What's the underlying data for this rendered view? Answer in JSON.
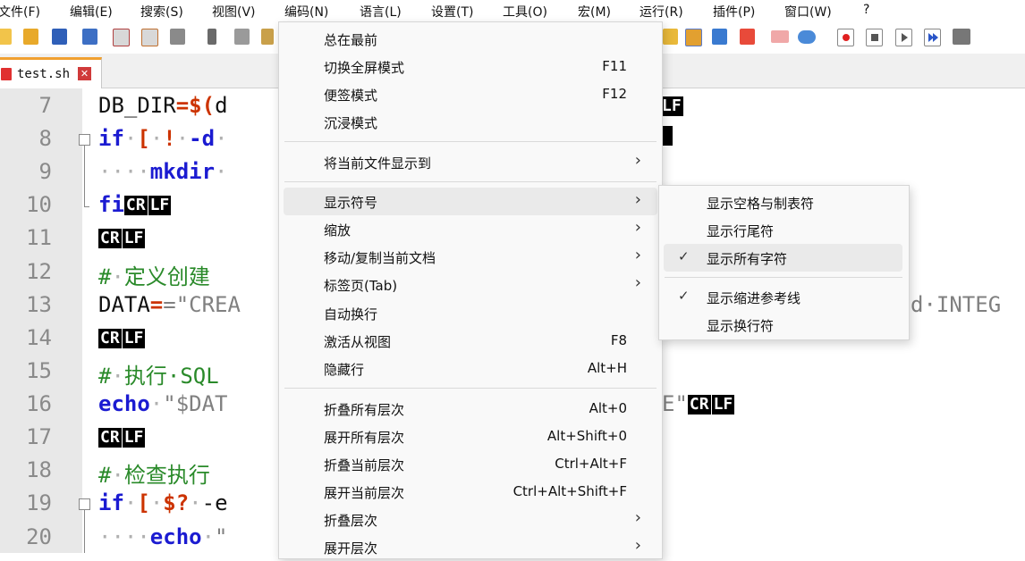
{
  "menubar": {
    "items": [
      "文件(F)",
      "编辑(E)",
      "搜索(S)",
      "视图(V)",
      "编码(N)",
      "语言(L)",
      "设置(T)",
      "工具(O)",
      "宏(M)",
      "运行(R)",
      "插件(P)",
      "窗口(W)",
      "?"
    ]
  },
  "toolbar": {
    "icons": [
      "new-file-icon",
      "open-folder-icon",
      "save-icon",
      "save-all-icon",
      "close-icon",
      "close-all-icon",
      "print-icon",
      "cut-icon",
      "copy-icon",
      "paste-icon",
      "sync-icon",
      "map-icon",
      "doc-icon",
      "function-icon",
      "folder-icon",
      "monitor-eye-icon",
      "record-macro-icon",
      "stop-macro-icon",
      "play-macro-icon",
      "play-multiple-icon",
      "save-macro-icon"
    ]
  },
  "tab": {
    "filename": "test.sh",
    "close_glyph": "✕"
  },
  "editor": {
    "line_numbers": [
      "7",
      "8",
      "9",
      "10",
      "11",
      "12",
      "13",
      "14",
      "15",
      "16",
      "17",
      "18",
      "19",
      "20"
    ],
    "line7": {
      "a": "DB_DIR",
      "b": "=$(",
      "c": "d"
    },
    "line8": {
      "a": "if",
      "b": "[",
      "c": "!",
      "d": "-d"
    },
    "line9": {
      "a": "mkdir"
    },
    "line10": {
      "a": "fi"
    },
    "line12": {
      "a": "#",
      "b": "定义创建"
    },
    "line13": {
      "a": "DATA",
      "b": "=\"CREA",
      "tail": "d·INTEG"
    },
    "line15": {
      "a": "#",
      "b": "执行·SQL"
    },
    "line16": {
      "a": "echo",
      "b": "\"$DAT",
      "tail": "E\""
    },
    "line18": {
      "a": "#",
      "b": "检查执行"
    },
    "line19": {
      "a": "if",
      "b": "[",
      "c": "$?",
      "d": "-e"
    },
    "line20": {
      "a": "echo",
      "b": "\""
    },
    "eol": {
      "cr": "CR",
      "lf": "LF"
    }
  },
  "view_menu": {
    "items": [
      {
        "label": "总在最前",
        "shortcut": ""
      },
      {
        "label": "切换全屏模式",
        "shortcut": "F11"
      },
      {
        "label": "便签模式",
        "shortcut": "F12"
      },
      {
        "label": "沉浸模式",
        "shortcut": ""
      },
      {
        "label": "将当前文件显示到",
        "shortcut": ""
      },
      {
        "label": "显示符号",
        "shortcut": ""
      },
      {
        "label": "缩放",
        "shortcut": ""
      },
      {
        "label": "移动/复制当前文档",
        "shortcut": ""
      },
      {
        "label": "标签页(Tab)",
        "shortcut": ""
      },
      {
        "label": "自动换行",
        "shortcut": ""
      },
      {
        "label": "激活从视图",
        "shortcut": "F8"
      },
      {
        "label": "隐藏行",
        "shortcut": "Alt+H"
      },
      {
        "label": "折叠所有层次",
        "shortcut": "Alt+0"
      },
      {
        "label": "展开所有层次",
        "shortcut": "Alt+Shift+0"
      },
      {
        "label": "折叠当前层次",
        "shortcut": "Ctrl+Alt+F"
      },
      {
        "label": "展开当前层次",
        "shortcut": "Ctrl+Alt+Shift+F"
      },
      {
        "label": "折叠层次",
        "shortcut": ""
      },
      {
        "label": "展开层次",
        "shortcut": ""
      }
    ],
    "submenu_arrow": "›"
  },
  "symbols_submenu": {
    "items": [
      {
        "label": "显示空格与制表符",
        "checked": false
      },
      {
        "label": "显示行尾符",
        "checked": false
      },
      {
        "label": "显示所有字符",
        "checked": true
      },
      {
        "label": "显示缩进参考线",
        "checked": true
      },
      {
        "label": "显示换行符",
        "checked": false
      }
    ],
    "check_glyph": "✓"
  }
}
